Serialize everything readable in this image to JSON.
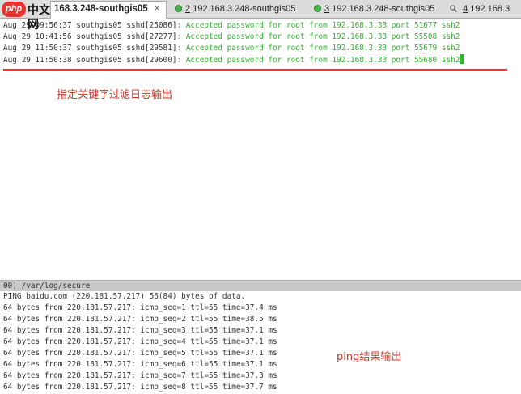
{
  "logo": {
    "badge": "php",
    "text": "中文网"
  },
  "tabs": [
    {
      "num": "",
      "title": "168.3.248-southgis05",
      "close": "×",
      "active": true
    },
    {
      "num": "2",
      "title": "192.168.3.248-southgis05",
      "active": false,
      "icon": "status-dot-icon"
    },
    {
      "num": "3",
      "title": "192.168.3.248-southgis05",
      "active": false,
      "icon": "status-dot-icon"
    },
    {
      "num": "4",
      "title": "192.168.3",
      "active": false,
      "icon": "search-icon"
    }
  ],
  "pane1": {
    "lines": [
      {
        "prefix": "Aug 29 09:56:37 southgis05 sshd[25086]",
        "msg": ": Accepted password for root from 192.168.3.33 port 51677 ssh2"
      },
      {
        "prefix": "Aug 29 10:41:56 southgis05 sshd[27277]",
        "msg": ": Accepted password for root from 192.168.3.33 port 55508 ssh2"
      },
      {
        "prefix": "Aug 29 11:50:37 southgis05 sshd[29581]",
        "msg": ": Accepted password for root from 192.168.3.33 port 55679 ssh2"
      },
      {
        "prefix": "Aug 29 11:50:38 southgis05 sshd[29600]",
        "msg": ": Accepted password for root from 192.168.3.33 port 55680 ssh2"
      }
    ]
  },
  "annotations": {
    "filter": "指定关键字过滤日志输出",
    "ping": "ping结果输出"
  },
  "statusbar": {
    "text": "00] /var/log/secure"
  },
  "pane2": {
    "lines": [
      "PING baidu.com (220.181.57.217) 56(84) bytes of data.",
      "64 bytes from 220.181.57.217: icmp_seq=1 ttl=55 time=37.4 ms",
      "64 bytes from 220.181.57.217: icmp_seq=2 ttl=55 time=38.5 ms",
      "64 bytes from 220.181.57.217: icmp_seq=3 ttl=55 time=37.1 ms",
      "64 bytes from 220.181.57.217: icmp_seq=4 ttl=55 time=37.1 ms",
      "64 bytes from 220.181.57.217: icmp_seq=5 ttl=55 time=37.1 ms",
      "64 bytes from 220.181.57.217: icmp_seq=6 ttl=55 time=37.1 ms",
      "64 bytes from 220.181.57.217: icmp_seq=7 ttl=55 time=37.3 ms",
      "64 bytes from 220.181.57.217: icmp_seq=8 ttl=55 time=37.7 ms"
    ]
  },
  "colors": {
    "accent_green": "#34b233",
    "annotation_red": "#e7332f"
  }
}
